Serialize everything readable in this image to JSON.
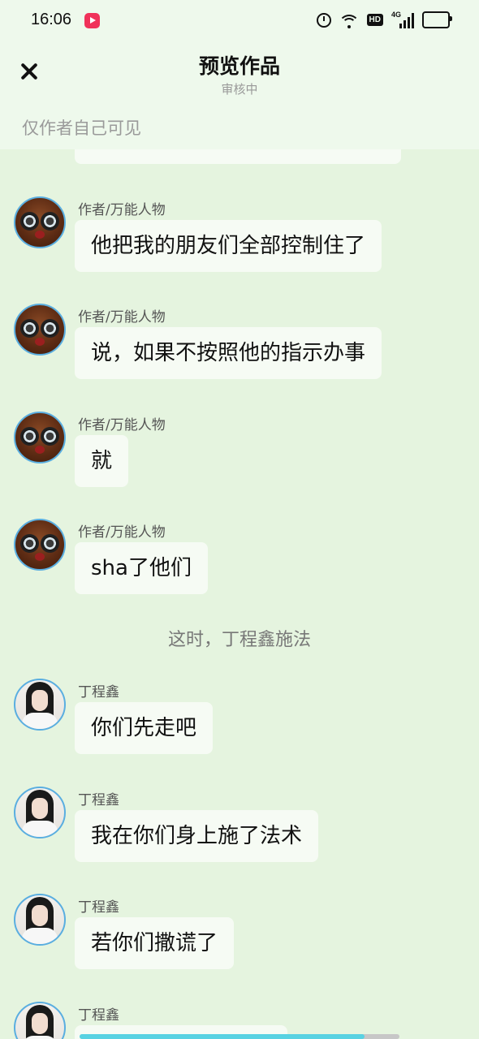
{
  "status_bar": {
    "time": "16:06",
    "app_icon": "video-app-icon",
    "icons": [
      "alarm-icon",
      "wifi-icon",
      "hd-icon",
      "signal-icon",
      "battery-icon"
    ],
    "hd_label": "HD",
    "network_label": "4G"
  },
  "header": {
    "title": "预览作品",
    "subtitle": "审核中",
    "visibility_note": "仅作者自己可见",
    "close_icon": "close-icon"
  },
  "messages": [
    {
      "sender": "作者/万能人物",
      "avatar": "author-avatar",
      "text": "他把我的朋友们全部控制住了"
    },
    {
      "sender": "作者/万能人物",
      "avatar": "author-avatar",
      "text": "说，如果不按照他的指示办事"
    },
    {
      "sender": "作者/万能人物",
      "avatar": "author-avatar",
      "text": "就"
    },
    {
      "sender": "作者/万能人物",
      "avatar": "author-avatar",
      "text": "sha了他们"
    },
    {
      "narration": "这时，丁程鑫施法"
    },
    {
      "sender": "丁程鑫",
      "avatar": "ding-avatar",
      "text": "你们先走吧"
    },
    {
      "sender": "丁程鑫",
      "avatar": "ding-avatar",
      "text": "我在你们身上施了法术"
    },
    {
      "sender": "丁程鑫",
      "avatar": "ding-avatar",
      "text": "若你们撒谎了"
    },
    {
      "sender": "丁程鑫",
      "avatar": "ding-avatar",
      "text": ""
    }
  ],
  "colors": {
    "background": "#e5f4df",
    "header_background": "#eef9ec",
    "bubble": "#f6fbf4",
    "avatar_border": "#5aaee0",
    "progress": "#58d2e2"
  },
  "progress": {
    "fraction": 0.89
  }
}
